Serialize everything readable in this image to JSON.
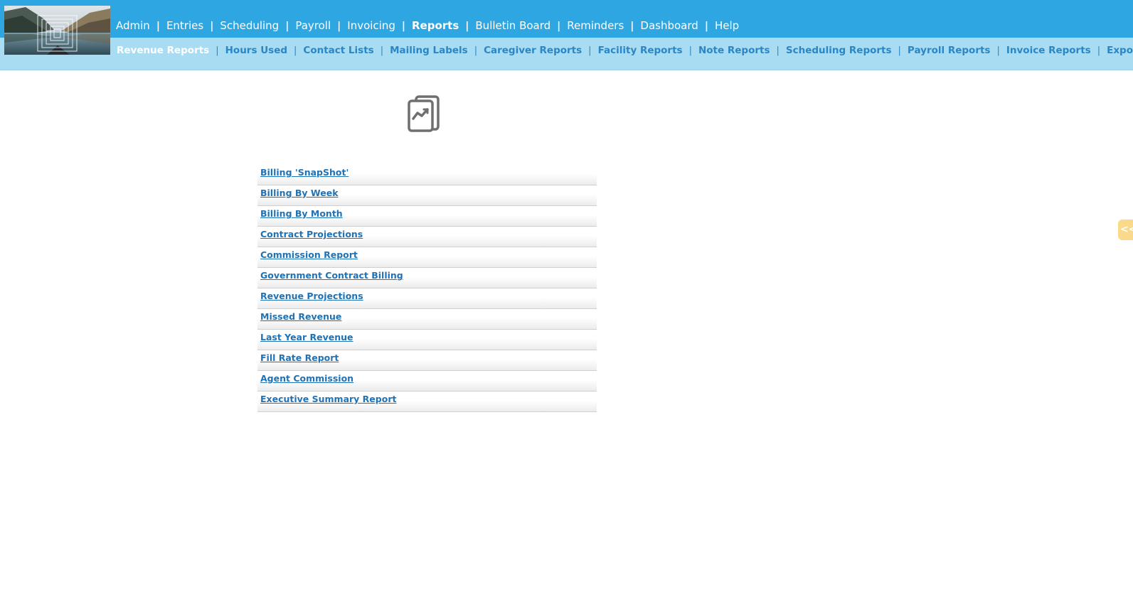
{
  "main_nav": [
    {
      "label": "Admin",
      "active": false
    },
    {
      "label": "Entries",
      "active": false
    },
    {
      "label": "Scheduling",
      "active": false
    },
    {
      "label": "Payroll",
      "active": false
    },
    {
      "label": "Invoicing",
      "active": false
    },
    {
      "label": "Reports",
      "active": true
    },
    {
      "label": "Bulletin Board",
      "active": false
    },
    {
      "label": "Reminders",
      "active": false
    },
    {
      "label": "Dashboard",
      "active": false
    },
    {
      "label": "Help",
      "active": false
    }
  ],
  "nav_separator": "|",
  "sub_nav": [
    {
      "label": "Revenue Reports",
      "active": true
    },
    {
      "label": "Hours Used",
      "active": false
    },
    {
      "label": "Contact Lists",
      "active": false
    },
    {
      "label": "Mailing Labels",
      "active": false
    },
    {
      "label": "Caregiver Reports",
      "active": false
    },
    {
      "label": "Facility Reports",
      "active": false
    },
    {
      "label": "Note Reports",
      "active": false
    },
    {
      "label": "Scheduling Reports",
      "active": false
    },
    {
      "label": "Payroll Reports",
      "active": false
    },
    {
      "label": "Invoice Reports",
      "active": false
    },
    {
      "label": "Export/",
      "active": false
    }
  ],
  "reports": [
    "Billing 'SnapShot'",
    "Billing By Week",
    "Billing By Month",
    "Contract Projections",
    "Commission Report",
    "Government Contract Billing",
    "Revenue Projections",
    "Missed Revenue",
    "Last Year Revenue",
    "Fill Rate Report",
    "Agent Commission",
    "Executive Summary Report"
  ],
  "side_tab": {
    "label": "<<"
  },
  "icons": {
    "page_icon": "report-chart-icon",
    "logo": "mountain-lake-logo"
  },
  "colors": {
    "top_bar": "#2ea6e2",
    "sub_bar": "#a8dcf3",
    "link": "#1f72b5",
    "sub_nav_text": "#2a86c4",
    "side_tab": "#fbd98a"
  }
}
